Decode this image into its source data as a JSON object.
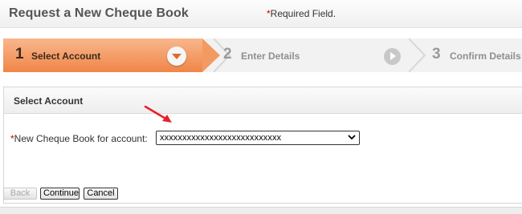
{
  "header": {
    "title": "Request a New Cheque Book",
    "required_star": "*",
    "required_text": "Required Field."
  },
  "steps": [
    {
      "number": "1",
      "label": "Select Account",
      "state": "active"
    },
    {
      "number": "2",
      "label": "Enter Details",
      "state": "inactive"
    },
    {
      "number": "3",
      "label": "Confirm Details",
      "state": "inactive"
    }
  ],
  "panel": {
    "title": "Select Account",
    "field_star": "*",
    "field_label": "New Cheque Book for account:",
    "account_value": "xxxxxxxxxxxxxxxxxxxxxxxxxxx"
  },
  "buttons": {
    "back": "Back",
    "continue": "Continue",
    "cancel": "Cancel"
  },
  "colors": {
    "active_step": "#f08548",
    "required_star": "#cc0000",
    "annotation_arrow": "#e8202a"
  },
  "icons": {
    "step1": "chevron-down-circle-icon",
    "step2": "play-circle-icon",
    "select": "chevron-down-icon",
    "annotation": "red-arrow-icon"
  }
}
